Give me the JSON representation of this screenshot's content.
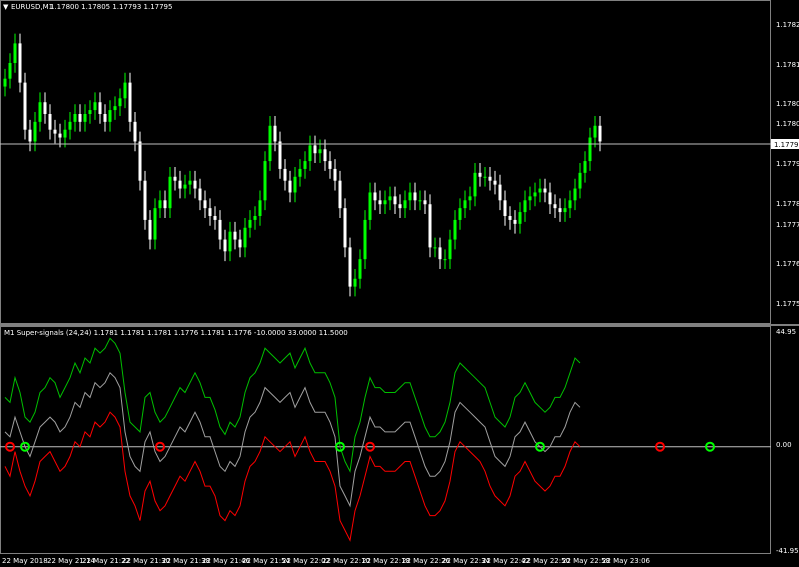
{
  "main_pane": {
    "symbol_label": "EURUSD,M1",
    "ohlc": "1.17800 1.17805 1.17793 1.17795",
    "price_labels": [
      "1.17825",
      "1.17815",
      "1.17805",
      "1.17800",
      "1.17790",
      "1.17780",
      "1.17775",
      "1.17765",
      "1.17755"
    ],
    "current_price": "1.17795",
    "colors": {
      "bull": "#00ff00",
      "bear": "#ffffff",
      "background": "#000000",
      "price_line": "#c0c0c0"
    }
  },
  "indicator_pane": {
    "title": "M1 Super-signals (24,24) 1.1781 1.1781 1.1781 1.1776 1.1781 1.1776 -10.0000 33.0000 11.5000",
    "scale_labels": [
      "44.95",
      "0.00",
      "-41.95"
    ],
    "colors": {
      "upper": "#00c000",
      "middle": "#a0a0a0",
      "lower": "#ff0000",
      "buy_signal": "#00ff00",
      "sell_signal": "#ff0000"
    }
  },
  "time_axis": {
    "labels": [
      "22 May 2018",
      "22 May 21:14",
      "22 May 21:22",
      "22 May 21:30",
      "22 May 21:38",
      "22 May 21:46",
      "22 May 21:54",
      "22 May 22:02",
      "22 May 22:10",
      "22 May 22:18",
      "22 May 22:26",
      "22 May 22:34",
      "22 May 22:42",
      "22 May 22:50",
      "22 May 22:58",
      "22 May 23:06"
    ]
  },
  "chart_data": {
    "type": "candlestick",
    "symbol": "EURUSD",
    "timeframe": "M1",
    "price_ylim": [
      1.1775,
      1.17828
    ],
    "closes": [
      1.17811,
      1.17815,
      1.1782,
      1.1781,
      1.17798,
      1.17795,
      1.178,
      1.17805,
      1.17802,
      1.17798,
      1.17797,
      1.17796,
      1.17798,
      1.178,
      1.17802,
      1.178,
      1.17802,
      1.17803,
      1.17805,
      1.17802,
      1.178,
      1.17803,
      1.17804,
      1.17806,
      1.1781,
      1.178,
      1.17795,
      1.17785,
      1.17775,
      1.1777,
      1.17778,
      1.1778,
      1.17778,
      1.17786,
      1.17785,
      1.17783,
      1.17784,
      1.17785,
      1.17783,
      1.1778,
      1.17778,
      1.17776,
      1.17775,
      1.1777,
      1.17767,
      1.17772,
      1.1777,
      1.17768,
      1.17773,
      1.17775,
      1.17776,
      1.1778,
      1.1779,
      1.17799,
      1.17795,
      1.17788,
      1.17785,
      1.17782,
      1.17786,
      1.17788,
      1.1779,
      1.17794,
      1.17792,
      1.17793,
      1.1779,
      1.17788,
      1.17785,
      1.17778,
      1.17768,
      1.17758,
      1.1776,
      1.17765,
      1.17775,
      1.17782,
      1.1778,
      1.17779,
      1.1778,
      1.17781,
      1.17779,
      1.17778,
      1.1778,
      1.17782,
      1.1778,
      1.1778,
      1.17779,
      1.17768,
      1.17768,
      1.17765,
      1.17765,
      1.1777,
      1.17775,
      1.17778,
      1.1778,
      1.17781,
      1.17787,
      1.17786,
      1.17786,
      1.17785,
      1.17784,
      1.1778,
      1.17776,
      1.17775,
      1.17774,
      1.17777,
      1.1778,
      1.17781,
      1.17782,
      1.17783,
      1.17782,
      1.17779,
      1.17778,
      1.17777,
      1.17778,
      1.1778,
      1.17783,
      1.17787,
      1.1779,
      1.17796,
      1.17799,
      1.17795
    ],
    "indicator": {
      "ylim": [
        -41.95,
        44.95
      ],
      "upper": [
        20,
        18,
        28,
        22,
        12,
        10,
        14,
        22,
        24,
        28,
        26,
        20,
        24,
        28,
        34,
        30,
        36,
        34,
        40,
        38,
        40,
        44,
        42,
        38,
        22,
        10,
        8,
        6,
        20,
        22,
        14,
        10,
        12,
        16,
        20,
        24,
        22,
        26,
        30,
        26,
        20,
        20,
        15,
        8,
        5,
        10,
        8,
        12,
        22,
        28,
        30,
        34,
        40,
        38,
        36,
        34,
        36,
        38,
        32,
        36,
        40,
        34,
        30,
        30,
        30,
        26,
        20,
        0,
        -6,
        -10,
        4,
        10,
        20,
        28,
        24,
        24,
        22,
        22,
        22,
        24,
        26,
        26,
        20,
        14,
        8,
        4,
        4,
        6,
        10,
        18,
        30,
        34,
        32,
        30,
        28,
        26,
        24,
        18,
        12,
        10,
        8,
        12,
        20,
        22,
        26,
        22,
        18,
        16,
        14,
        16,
        20,
        20,
        24,
        30,
        36,
        34
      ],
      "middle": [
        6,
        4,
        12,
        6,
        0,
        -4,
        2,
        8,
        10,
        12,
        10,
        6,
        8,
        12,
        18,
        16,
        22,
        20,
        26,
        24,
        26,
        30,
        28,
        24,
        6,
        -4,
        -8,
        -10,
        2,
        6,
        -2,
        -6,
        -4,
        0,
        4,
        8,
        6,
        10,
        14,
        10,
        4,
        4,
        -2,
        -8,
        -10,
        -6,
        -8,
        -4,
        6,
        12,
        14,
        18,
        24,
        22,
        20,
        18,
        20,
        22,
        16,
        20,
        24,
        18,
        14,
        14,
        14,
        10,
        4,
        -16,
        -20,
        -24,
        -10,
        -4,
        4,
        12,
        8,
        8,
        6,
        6,
        6,
        8,
        10,
        10,
        4,
        -2,
        -8,
        -12,
        -12,
        -10,
        -6,
        2,
        14,
        18,
        16,
        14,
        12,
        10,
        8,
        2,
        -4,
        -6,
        -8,
        -4,
        4,
        6,
        10,
        6,
        2,
        0,
        -2,
        0,
        4,
        4,
        8,
        14,
        18,
        16
      ],
      "lower": [
        -8,
        -12,
        -2,
        -10,
        -16,
        -20,
        -14,
        -6,
        -4,
        -2,
        -6,
        -10,
        -8,
        -4,
        2,
        0,
        6,
        4,
        10,
        8,
        10,
        14,
        12,
        8,
        -10,
        -20,
        -24,
        -30,
        -18,
        -14,
        -22,
        -26,
        -24,
        -20,
        -16,
        -12,
        -14,
        -10,
        -6,
        -10,
        -16,
        -16,
        -20,
        -28,
        -30,
        -26,
        -28,
        -24,
        -14,
        -8,
        -6,
        -2,
        4,
        2,
        0,
        -2,
        0,
        2,
        -4,
        0,
        4,
        -2,
        -6,
        -6,
        -6,
        -10,
        -16,
        -30,
        -34,
        -38,
        -26,
        -20,
        -12,
        -4,
        -8,
        -8,
        -10,
        -10,
        -10,
        -8,
        -6,
        -6,
        -12,
        -18,
        -24,
        -28,
        -28,
        -26,
        -22,
        -14,
        -2,
        2,
        0,
        -2,
        -4,
        -6,
        -10,
        -16,
        -20,
        -22,
        -24,
        -20,
        -12,
        -10,
        -6,
        -10,
        -14,
        -16,
        -18,
        -16,
        -12,
        -12,
        -8,
        -2,
        2,
        0
      ],
      "sell_signals": [
        1,
        31,
        73,
        131,
        166
      ],
      "buy_signals": [
        4,
        67,
        107,
        141,
        173
      ]
    }
  }
}
